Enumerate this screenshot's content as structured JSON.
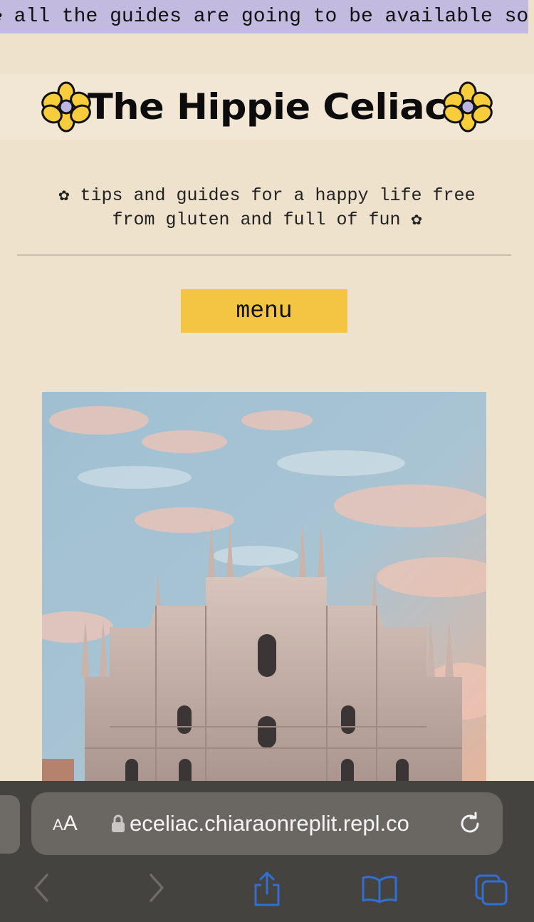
{
  "banner": {
    "text": "✿ all the guides are going to be available soon"
  },
  "header": {
    "title": "The Hippie Celiac",
    "left_icon": "flower-icon",
    "right_icon": "flower-icon"
  },
  "tagline": {
    "line1": "✿ tips and guides for a happy life free",
    "line2": "from gluten and full of fun ✿"
  },
  "menu": {
    "label": "menu"
  },
  "hero": {
    "icon": "cathedral-photo"
  },
  "browser": {
    "text_size_label": "AA",
    "url": "eceliac.chiaraonreplit.repl.co",
    "icons": [
      "lock-icon",
      "reload-icon",
      "back-icon",
      "forward-icon",
      "share-icon",
      "bookmarks-icon",
      "tabs-icon"
    ]
  },
  "colors": {
    "background": "#efe2cd",
    "banner": "#c3bae0",
    "menu_button": "#f4c542",
    "flower": "#f7cd3b",
    "flower_center": "#b9b4e0",
    "browser_bar": "#45433f",
    "nav_icon": "#2f6fd6"
  }
}
